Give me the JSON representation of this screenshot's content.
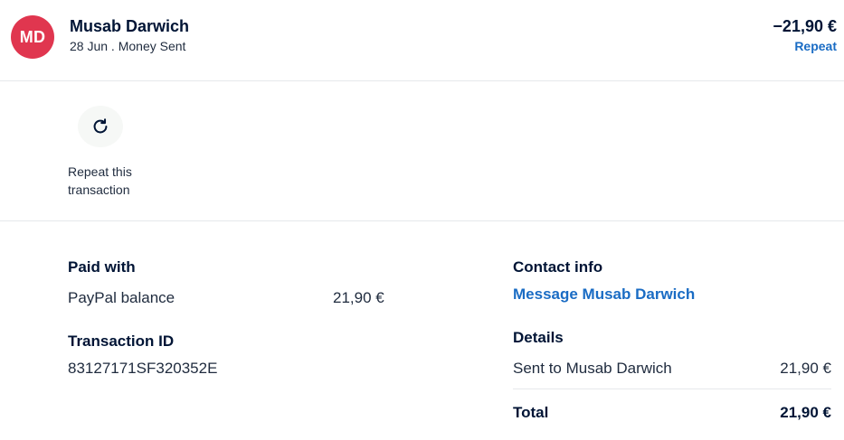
{
  "header": {
    "avatar_initials": "MD",
    "name": "Musab Darwich",
    "subline": "28 Jun . Money Sent",
    "amount": "−21,90 €",
    "repeat_label": "Repeat"
  },
  "actions": {
    "repeat_icon": "refresh-icon",
    "repeat_label_line1": "Repeat this",
    "repeat_label_line2": "transaction"
  },
  "payment": {
    "paid_with_heading": "Paid with",
    "method": "PayPal balance",
    "method_amount": "21,90 €",
    "transaction_id_heading": "Transaction ID",
    "transaction_id": "83127171SF320352E"
  },
  "contact": {
    "heading": "Contact info",
    "message_link": "Message Musab Darwich"
  },
  "details": {
    "heading": "Details",
    "line_label": "Sent to Musab Darwich",
    "line_amount": "21,90 €",
    "total_label": "Total",
    "total_amount": "21,90 €"
  },
  "colors": {
    "avatar_bg": "#e0364f",
    "link": "#1a6cc4",
    "text_dark": "#001435"
  }
}
